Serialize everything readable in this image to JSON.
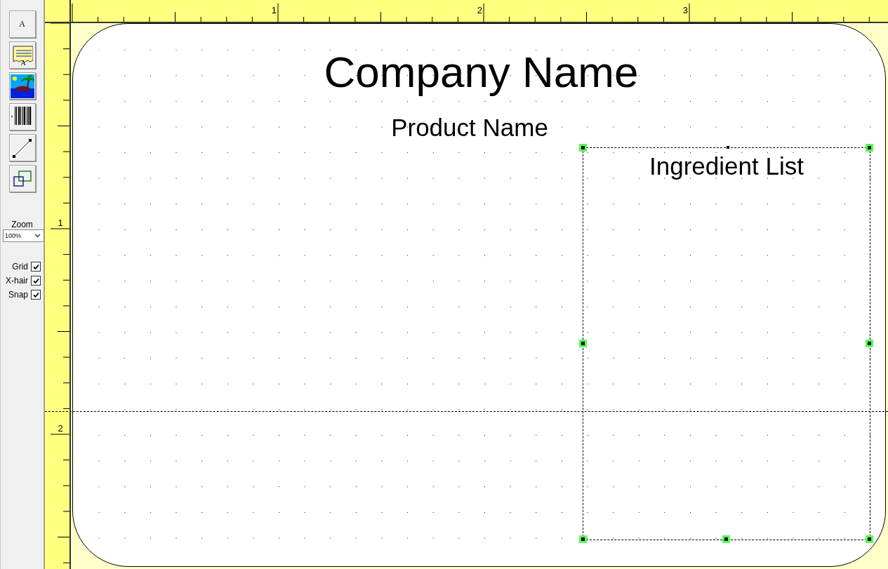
{
  "toolbar": {
    "tools": [
      {
        "kind": "text",
        "glyph": "A"
      },
      {
        "kind": "paragraph",
        "glyph": "A"
      },
      {
        "kind": "image"
      },
      {
        "kind": "barcode"
      },
      {
        "kind": "line"
      },
      {
        "kind": "shape"
      }
    ],
    "zoom": {
      "label": "Zoom",
      "value": "100%"
    },
    "options": [
      {
        "label": "Grid",
        "checked": true
      },
      {
        "label": "X-hair",
        "checked": true
      },
      {
        "label": "Snap",
        "checked": true
      }
    ]
  },
  "rulers": {
    "x_labels": [
      "1",
      "2",
      "3"
    ],
    "y_labels": [
      "1",
      "2"
    ]
  },
  "label": {
    "objects": [
      {
        "kind": "heading",
        "text": "Company Name",
        "selected": false
      },
      {
        "kind": "subheading",
        "text": "Product Name",
        "selected": false
      },
      {
        "kind": "list",
        "text": "Ingredient List",
        "selected": true
      }
    ]
  }
}
